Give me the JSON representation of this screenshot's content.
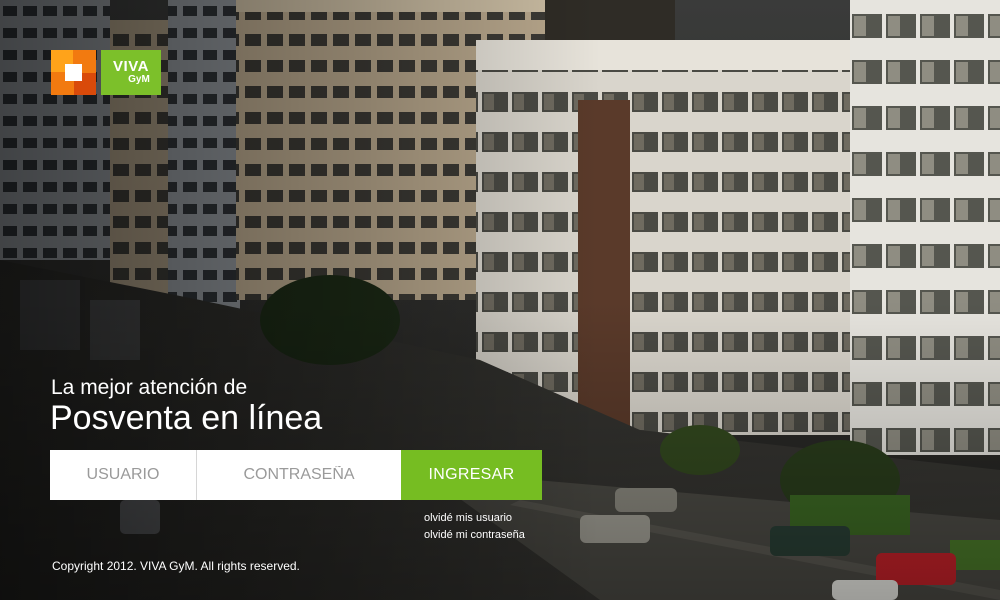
{
  "logo": {
    "brand_line1": "VIVA",
    "brand_line2": "GyM",
    "colors": {
      "orange": "#f27a10",
      "green": "#7cc02a"
    }
  },
  "hero": {
    "tagline": "La mejor atención de",
    "headline": "Posventa en línea"
  },
  "login": {
    "username_placeholder": "USUARIO",
    "password_placeholder": "CONTRASEÑA",
    "submit_label": "INGRESAR",
    "accent_color": "#76bd22"
  },
  "links": {
    "forgot_user": "olvidé mis usuario",
    "forgot_password": "olvidé mi contraseña"
  },
  "footer": {
    "copyright": "Copyright 2012. VIVA GyM. All rights reserved."
  }
}
